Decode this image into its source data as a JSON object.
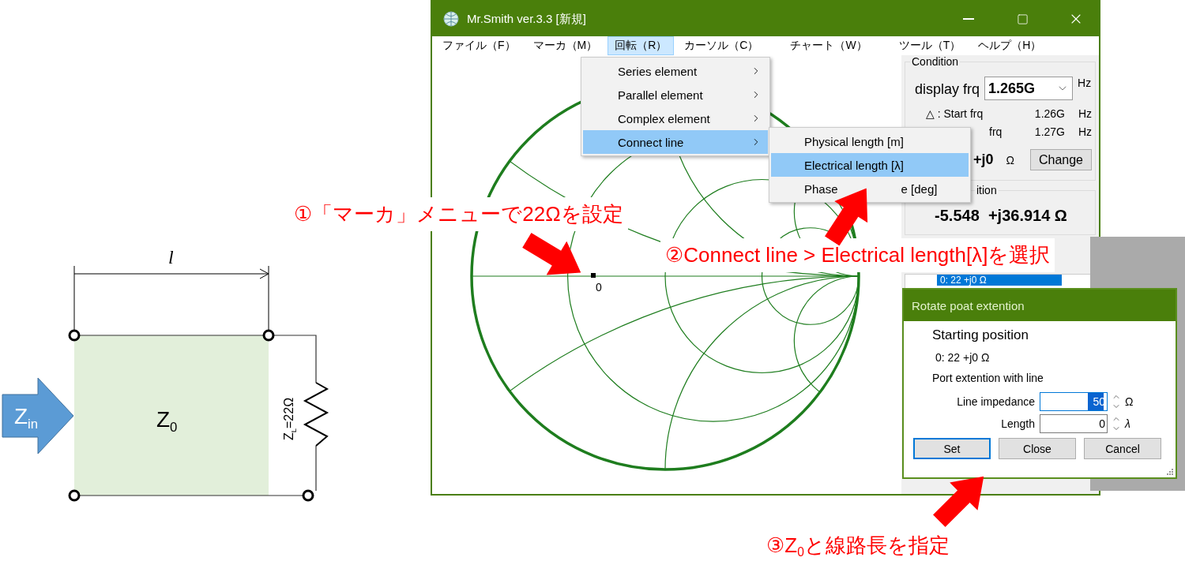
{
  "diagram": {
    "length_label": "l",
    "input_label": "Z$_{in}$",
    "line_label": "Z$_{0}$",
    "load_label": "Z$_{L}$=22Ω"
  },
  "window": {
    "title": "Mr.Smith ver.3.3 [新規]"
  },
  "menu_bar": [
    {
      "label": "ファイル（F）",
      "selected": false
    },
    {
      "label": "マーカ（M）",
      "selected": false
    },
    {
      "label": "回転（R）",
      "selected": true
    },
    {
      "label": "カーソル（C）",
      "selected": false
    },
    {
      "label": "チャート（W）",
      "selected": false
    },
    {
      "label": "ツール（T）",
      "selected": false
    },
    {
      "label": "ヘルプ（H）",
      "selected": false
    }
  ],
  "menu": {
    "items": [
      {
        "label": "Series element",
        "selected": false
      },
      {
        "label": "Parallel element",
        "selected": false
      },
      {
        "label": "Complex element",
        "selected": false
      },
      {
        "label": "Connect line",
        "selected": true
      }
    ]
  },
  "submenu": {
    "items": [
      {
        "label": "Physical length [m]",
        "selected": false
      },
      {
        "label": "Electrical length [λ]",
        "selected": true
      },
      {
        "label": "Phase",
        "label_tail": "e [deg]",
        "selected": false
      }
    ]
  },
  "chart": {
    "marker_label": "0"
  },
  "condition": {
    "title": "Condition",
    "display_frq_label": "display frq",
    "display_frq": "1.265G",
    "display_frq_unit": "Hz",
    "rows": [
      {
        "label": "△ : Start frq",
        "value": "1.26G",
        "unit": "Hz"
      },
      {
        "label": "frq",
        "value": "1.27G",
        "unit": "Hz"
      }
    ],
    "load_value": "+j0",
    "load_unit": "Ω",
    "change_button": "Change"
  },
  "position": {
    "title": "ition",
    "value": "-5.548  +j36.914 Ω",
    "list": [
      {
        "label": "0: 22 +j0 Ω",
        "selected": true
      }
    ]
  },
  "dialog": {
    "title": "Rotate poat extention",
    "heading": "Starting position",
    "start": "0: 22 +j0 Ω",
    "section": "Port extention with line",
    "fields": [
      {
        "label": "Line impedance",
        "value": "50",
        "unit": "Ω",
        "focused": true
      },
      {
        "label": "Length",
        "value": "0",
        "unit": "λ",
        "focused": false
      }
    ],
    "buttons": [
      {
        "label": "Set",
        "default": true
      },
      {
        "label": "Close",
        "default": false
      },
      {
        "label": "Cancel",
        "default": false
      }
    ]
  },
  "callouts": [
    {
      "text": "①「マーカ」メニューで22Ωを設定"
    },
    {
      "text": "②Connect line > Electrical length[λ]を選択"
    },
    {
      "text": "③Z$_{0}$と線路長を指定"
    }
  ]
}
